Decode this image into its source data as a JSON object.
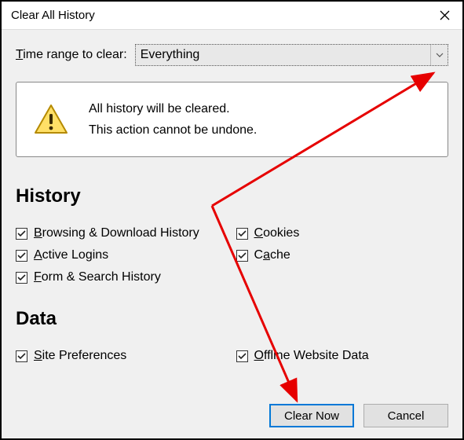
{
  "window": {
    "title": "Clear All History"
  },
  "timerange": {
    "label_pre": "T",
    "label_rest": "ime range to clear:",
    "selected": "Everything"
  },
  "warning": {
    "line1": "All history will be cleared.",
    "line2": "This action cannot be undone."
  },
  "sections": {
    "history_title": "History",
    "data_title": "Data"
  },
  "checks": {
    "browsing": {
      "u": "B",
      "rest": "rowsing & Download History",
      "checked": true
    },
    "cookies": {
      "u": "C",
      "rest": "ookies",
      "checked": true
    },
    "logins": {
      "u": "A",
      "rest": "ctive Logins",
      "checked": true
    },
    "cache": {
      "pre": "C",
      "u": "a",
      "rest": "che",
      "checked": true
    },
    "form": {
      "u": "F",
      "rest": "orm & Search History",
      "checked": true
    },
    "siteprefs": {
      "u": "S",
      "rest": "ite Preferences",
      "checked": true
    },
    "offline": {
      "u": "O",
      "rest": "ffline Website Data",
      "checked": true
    }
  },
  "buttons": {
    "clear": "Clear Now",
    "cancel": "Cancel"
  },
  "colors": {
    "accent": "#0078d7",
    "arrow": "#e60000"
  }
}
